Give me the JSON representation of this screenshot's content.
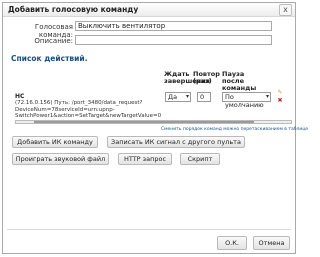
{
  "dialog": {
    "title": "Добавить голосовую команду",
    "close_glyph": "x"
  },
  "form": {
    "voice_label": "Голосовая команда:",
    "voice_value": "Выключить вентилятор",
    "desc_label": "Описание:",
    "desc_value": ""
  },
  "actions": {
    "section_title": "Список действий.",
    "columns": {
      "wait": "Ждать завершения",
      "repeat": "Повтор (раз)",
      "pause": "Пауза после команды"
    },
    "items": [
      {
        "name": "HC",
        "url": "(72.16.0.156) Путь: /port_3480/data_request?DeviceNum=78serviceId=urn:upnp-SwitchPower1&action=SetTarget&newTargetValue=0",
        "wait": "Да",
        "repeat": "0",
        "pause": "По умолчанию"
      }
    ],
    "hint": "Сменить порядок команд можно перетаскиванием в таблице"
  },
  "buttons": {
    "add_ir": "Добавить ИК команду",
    "record_ir": "Записать ИК сигнал с другого пульта",
    "play_sound": "Проиграть звуковой файл",
    "http": "HTTP запрос",
    "script": "Скрипт",
    "ok": "О.К.",
    "cancel": "Отмена"
  },
  "colors": {
    "section": "#1a4f8a",
    "edit_icon": "#d4a017",
    "delete_icon": "#cc2222"
  }
}
